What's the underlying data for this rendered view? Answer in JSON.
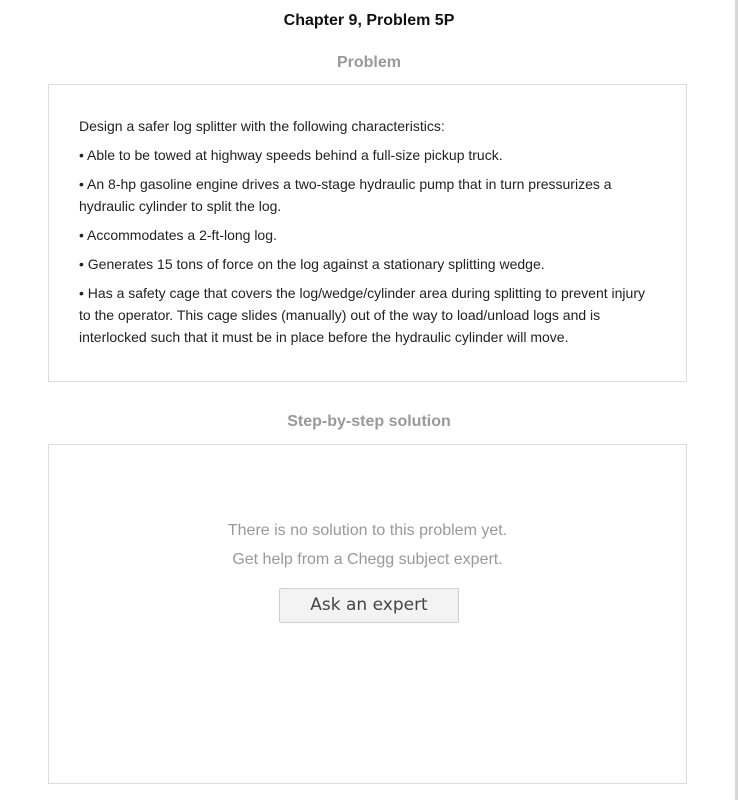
{
  "header": {
    "title": "Chapter 9, Problem 5P"
  },
  "problem": {
    "heading": "Problem",
    "lines": [
      "Design a safer log splitter with the following characteristics:",
      "• Able to be towed at highway speeds behind a full-size pickup truck.",
      "• An 8-hp gasoline engine drives a two-stage hydraulic pump that in turn pressurizes a hydraulic cylinder to split the log.",
      "• Accommodates a 2-ft-long log.",
      "• Generates 15 tons of force on the log against a stationary splitting wedge.",
      "• Has a safety cage that covers the log/wedge/cylinder area during splitting to prevent injury to the operator. This cage slides (manually) out of the way to load/unload logs and is interlocked such that it must be in place before the hydraulic cylinder will move."
    ]
  },
  "solution": {
    "heading": "Step-by-step solution",
    "no_solution_text": "There is no solution to this problem yet.",
    "get_help_text": "Get help from a Chegg subject expert.",
    "ask_button_label": "Ask an expert"
  }
}
